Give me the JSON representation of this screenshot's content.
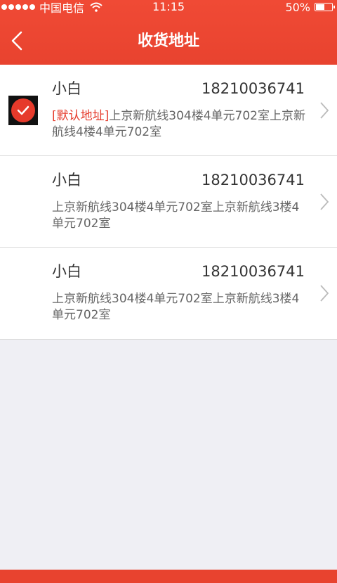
{
  "status_bar": {
    "carrier": "中国电信",
    "time": "11:15",
    "battery": "50%"
  },
  "nav": {
    "title": "收货地址"
  },
  "addresses": [
    {
      "name": "小白",
      "phone": "18210036741",
      "default_tag": "[默认地址]",
      "address": "上京新航线304楼4单元702室上京新航线4楼4单元702室",
      "is_default": true
    },
    {
      "name": "小白",
      "phone": "18210036741",
      "address": "上京新航线304楼4单元702室上京新航线3楼4单元702室",
      "is_default": false
    },
    {
      "name": "小白",
      "phone": "18210036741",
      "address": "上京新航线304楼4单元702室上京新航线3楼4单元702室",
      "is_default": false
    }
  ],
  "colors": {
    "accent": "#e8432f",
    "background": "#efeff4",
    "default_tag": "#e53a2a"
  }
}
